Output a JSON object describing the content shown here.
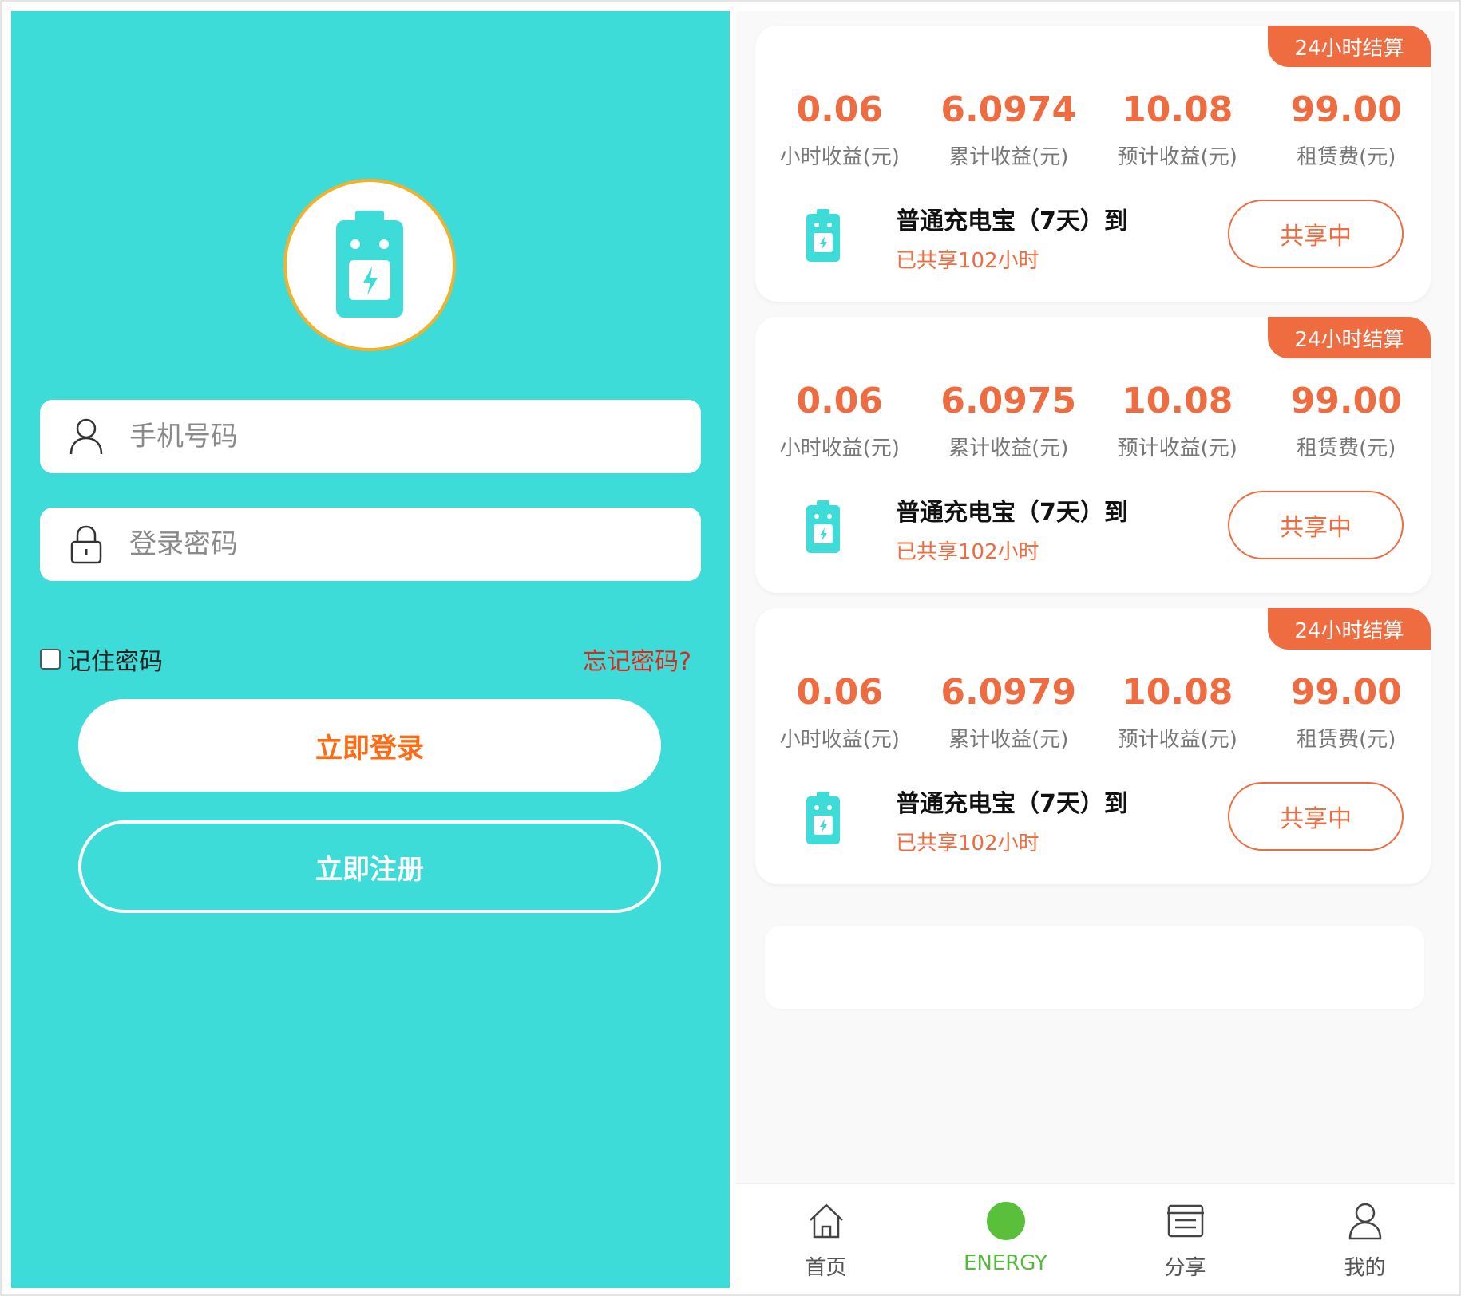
{
  "login": {
    "phone_placeholder": "手机号码",
    "password_placeholder": "登录密码",
    "remember_label": "记住密码",
    "forgot_label": "忘记密码?",
    "login_button": "立即登录",
    "register_button": "立即注册",
    "icons": {
      "logo": "battery-icon",
      "phone": "user-icon",
      "password": "lock-icon"
    },
    "colors": {
      "background": "#3ddcd9",
      "login_text": "#ff6a12",
      "forgot_text": "#e0261b",
      "logo_ring": "#f2b12a"
    }
  },
  "cards": [
    {
      "tag": "24小时结算",
      "stats": [
        {
          "value": "0.06",
          "label": "小时收益(元)"
        },
        {
          "value": "6.0974",
          "label": "累计收益(元)"
        },
        {
          "value": "10.08",
          "label": "预计收益(元)"
        },
        {
          "value": "99.00",
          "label": "租赁费(元)"
        }
      ],
      "item_name": "普通充电宝（7天）到",
      "item_sub": "已共享102小时",
      "button": "共享中"
    },
    {
      "tag": "24小时结算",
      "stats": [
        {
          "value": "0.06",
          "label": "小时收益(元)"
        },
        {
          "value": "6.0975",
          "label": "累计收益(元)"
        },
        {
          "value": "10.08",
          "label": "预计收益(元)"
        },
        {
          "value": "99.00",
          "label": "租赁费(元)"
        }
      ],
      "item_name": "普通充电宝（7天）到",
      "item_sub": "已共享102小时",
      "button": "共享中"
    },
    {
      "tag": "24小时结算",
      "stats": [
        {
          "value": "0.06",
          "label": "小时收益(元)"
        },
        {
          "value": "6.0979",
          "label": "累计收益(元)"
        },
        {
          "value": "10.08",
          "label": "预计收益(元)"
        },
        {
          "value": "99.00",
          "label": "租赁费(元)"
        }
      ],
      "item_name": "普通充电宝（7天）到",
      "item_sub": "已共享102小时",
      "button": "共享中"
    }
  ],
  "tabbar": {
    "items": [
      {
        "label": "首页",
        "icon": "home-icon"
      },
      {
        "label": "ENERGY",
        "icon": "energy-dot-icon",
        "active": true
      },
      {
        "label": "分享",
        "icon": "list-icon"
      },
      {
        "label": "我的",
        "icon": "profile-icon"
      }
    ],
    "colors": {
      "active": "#56b93c"
    }
  },
  "accent_color": "#ee6c3f"
}
